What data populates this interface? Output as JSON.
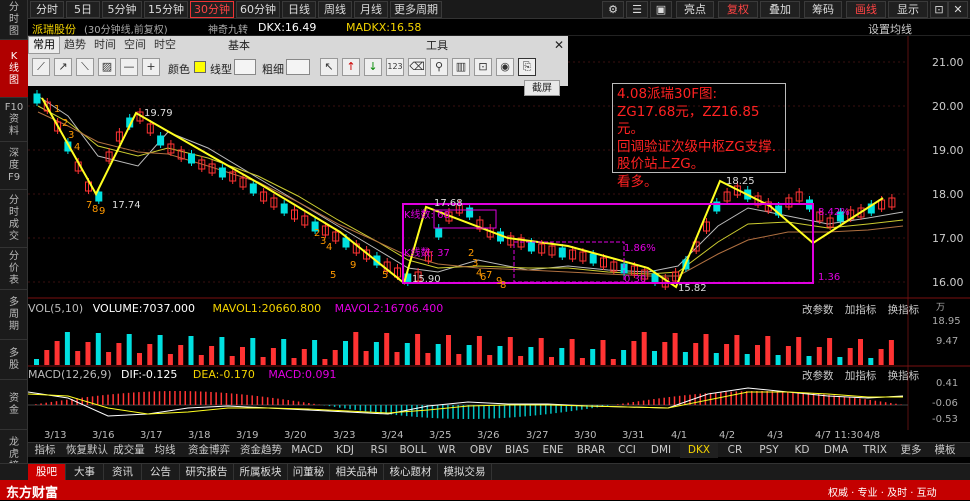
{
  "left_sidebar": [
    "分时图",
    "K线图",
    "F10资料",
    "深度F9",
    "分时成交",
    "分价表",
    "多周期",
    "多股",
    "资金",
    "龙虎榜"
  ],
  "left_sidebar_lines": [
    [
      "分",
      "时",
      "图"
    ],
    [
      "K",
      "线",
      "图"
    ],
    [
      "F10",
      "资",
      "料"
    ],
    [
      "深",
      "度",
      "F9"
    ],
    [
      "分",
      "时",
      "成",
      "交"
    ],
    [
      "分",
      "价",
      "表"
    ],
    [
      "多",
      "周",
      "期"
    ],
    [
      "多",
      "股"
    ],
    [
      "资",
      "金"
    ],
    [
      "龙",
      "虎",
      "榜"
    ]
  ],
  "top": {
    "periods": [
      "分时",
      "5日",
      "5分钟",
      "15分钟",
      "30分钟",
      "60分钟",
      "日线",
      "周线",
      "月线",
      "更多周期"
    ],
    "active_period": "30分钟",
    "right_buttons": [
      "亮点",
      "复权",
      "叠加",
      "筹码",
      "画线",
      "显示"
    ]
  },
  "title": {
    "stock": "派瑞股份",
    "info": "(30分钟线,前复权)",
    "indicator": "神奇九转",
    "dkx": "DKX:16.49",
    "madkx": "MADKX:16.58",
    "settings": "设置均线"
  },
  "toolbox": {
    "tabs": [
      "常用",
      "趋势",
      "时间",
      "空间",
      "时空"
    ],
    "basic": "基本",
    "tools": "工具",
    "color_label": "颜色",
    "line_label": "线型",
    "thick_label": "粗细",
    "screenshot": "截屏"
  },
  "y_axis": [
    "21.00",
    "20.00",
    "19.00",
    "18.00",
    "17.00",
    "16.00"
  ],
  "price_labels": {
    "high1": "19.79",
    "low1": "17.74",
    "box_top": "17.68",
    "box_low": "15.90",
    "high2": "18.25",
    "low2": "15.82",
    "pct1": "1.86%",
    "pct2": "8.42%",
    "pct3": "0.30",
    "pct4": "1.36",
    "kline_count": "K线数: 68",
    "kline_count2": "K线数: 37"
  },
  "annotation": "4.08派瑞30F图:\nZG17.68元，ZZ16.85元。\n回调验证次级中枢ZG支撑.\n股价站上ZG。\n看多。",
  "volume": {
    "title": "VOL(5,10)",
    "volume": "VOLUME:7037.000",
    "mavol1": "MAVOL1:20660.800",
    "mavol2": "MAVOL2:16706.400",
    "y_axis": [
      "万",
      "18.95",
      "9.47"
    ],
    "buttons": [
      "改参数",
      "加指标",
      "换指标"
    ]
  },
  "macd": {
    "title": "MACD(12,26,9)",
    "dif": "DIF:-0.125",
    "dea": "DEA:-0.170",
    "macd": "MACD:0.091",
    "y_axis": [
      "0.41",
      "-0.06",
      "-0.53"
    ],
    "buttons": [
      "改参数",
      "加指标",
      "换指标"
    ]
  },
  "dates": [
    "3/13",
    "3/16",
    "3/17",
    "3/18",
    "3/19",
    "3/20",
    "3/23",
    "3/24",
    "3/25",
    "3/26",
    "3/27",
    "3/30",
    "3/31",
    "4/1",
    "4/2",
    "4/3",
    "4/7 11:30",
    "4/8"
  ],
  "indicator_tabs": [
    "指标",
    "恢复默认",
    "成交量",
    "均线",
    "资金博弈",
    "资金趋势",
    "MACD",
    "KDJ",
    "RSI",
    "BOLL",
    "WR",
    "OBV",
    "BIAS",
    "ENE",
    "BRAR",
    "CCI",
    "DMI",
    "DKX",
    "CR",
    "PSY",
    "KD",
    "DMA",
    "TRIX",
    "更多",
    "模板"
  ],
  "bottom_nav": [
    "股吧",
    "大事",
    "资讯",
    "公告",
    "研究报告",
    "所属板块",
    "问董秘",
    "相关品种",
    "核心题材",
    "模拟交易"
  ],
  "footer": {
    "brand": "东方财富",
    "slogan": "权威 · 专业 · 及时 · 互动"
  },
  "colors": {
    "accent": "#ff2020",
    "box": "#e000e0",
    "pen": "#ffff20",
    "up": "#ff3333",
    "down": "#00e0e0"
  }
}
